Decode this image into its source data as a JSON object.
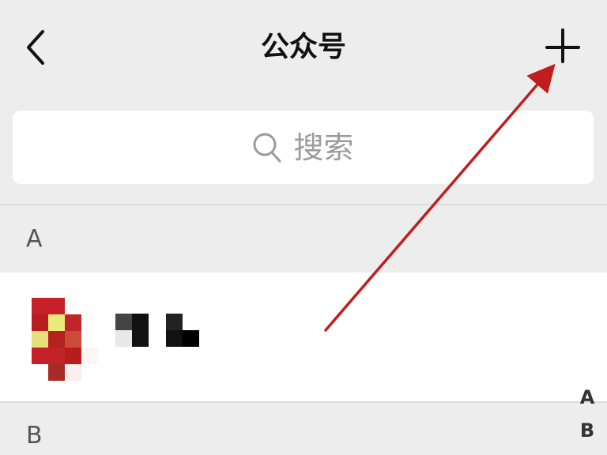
{
  "header": {
    "title": "公众号",
    "back_icon": "chevron-left-icon",
    "add_icon": "plus-icon"
  },
  "search": {
    "placeholder": "搜索",
    "icon": "search-icon"
  },
  "sections": [
    {
      "letter": "A"
    },
    {
      "letter": "B"
    }
  ],
  "list": {
    "items": [
      {
        "name": "",
        "avatar": "pixelated-avatar"
      }
    ]
  },
  "index": {
    "letters": [
      "A",
      "B"
    ]
  },
  "annotation": {
    "color": "#c01d1d",
    "target": "add-button"
  },
  "colors": {
    "background": "#ededed",
    "card": "#ffffff",
    "title": "#111111",
    "placeholder": "#9b9b9b"
  }
}
